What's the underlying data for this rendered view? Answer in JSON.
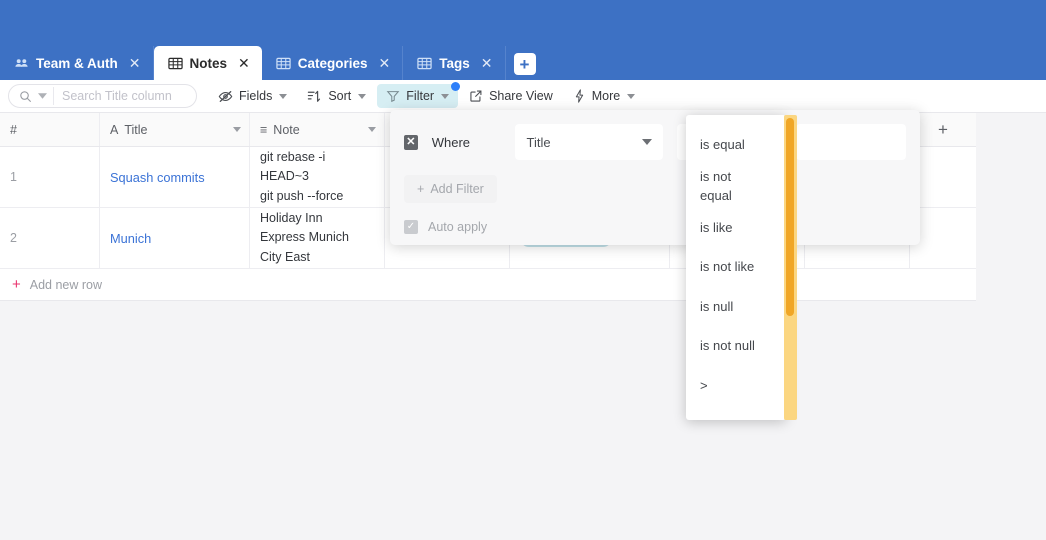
{
  "colors": {
    "topbar_blue": "#3d71c4",
    "active_btn_bg": "#d6eef3",
    "badge_blue": "#2d7ff9",
    "link_blue": "#3b73d6",
    "add_row_pink": "#e8336d",
    "scrollbar_track": "#fbd681",
    "scrollbar_thumb": "#f0a626",
    "pill_teal": "#b6dbe4"
  },
  "tabs": [
    {
      "label": "Team & Auth",
      "icon": "people-icon",
      "active": false,
      "close": "✕"
    },
    {
      "label": "Notes",
      "icon": "table-icon",
      "active": true,
      "close": "✕"
    },
    {
      "label": "Categories",
      "icon": "table-icon",
      "active": false,
      "close": "✕"
    },
    {
      "label": "Tags",
      "icon": "table-icon",
      "active": false,
      "close": "✕"
    }
  ],
  "add_tab_label": "+",
  "toolbar": {
    "search": {
      "icon": "search-icon",
      "placeholder": "Search Title column",
      "value": ""
    },
    "fields_label": "Fields",
    "sort_label": "Sort",
    "filter_label": "Filter",
    "share_view_label": "Share View",
    "more_label": "More"
  },
  "grid": {
    "columns": [
      {
        "key": "num",
        "label": "#",
        "icon": ""
      },
      {
        "key": "tit",
        "label": "Title",
        "icon": "A"
      },
      {
        "key": "note",
        "label": "Note",
        "icon": "≡"
      }
    ],
    "add_column_label": "+",
    "rows": [
      {
        "num": "1",
        "title": "Squash commits",
        "note": "git rebase -i\nHEAD~3\ngit push --force"
      },
      {
        "num": "2",
        "title": "Munich",
        "note": "Holiday Inn\nExpress Munich\nCity East"
      }
    ],
    "add_new_row_label": "Add new row"
  },
  "filter_panel": {
    "delete_label": "✕",
    "where_label": "Where",
    "field_value": "Title",
    "add_filter_label": "Add Filter",
    "add_filter_plus": "+",
    "auto_apply_label": "Auto apply",
    "auto_apply_checked": true,
    "check_glyph": "✓"
  },
  "operator_menu": {
    "items": [
      "is equal",
      "is not equal",
      "is like",
      "is not like",
      "is null",
      "is not null",
      ">"
    ]
  }
}
